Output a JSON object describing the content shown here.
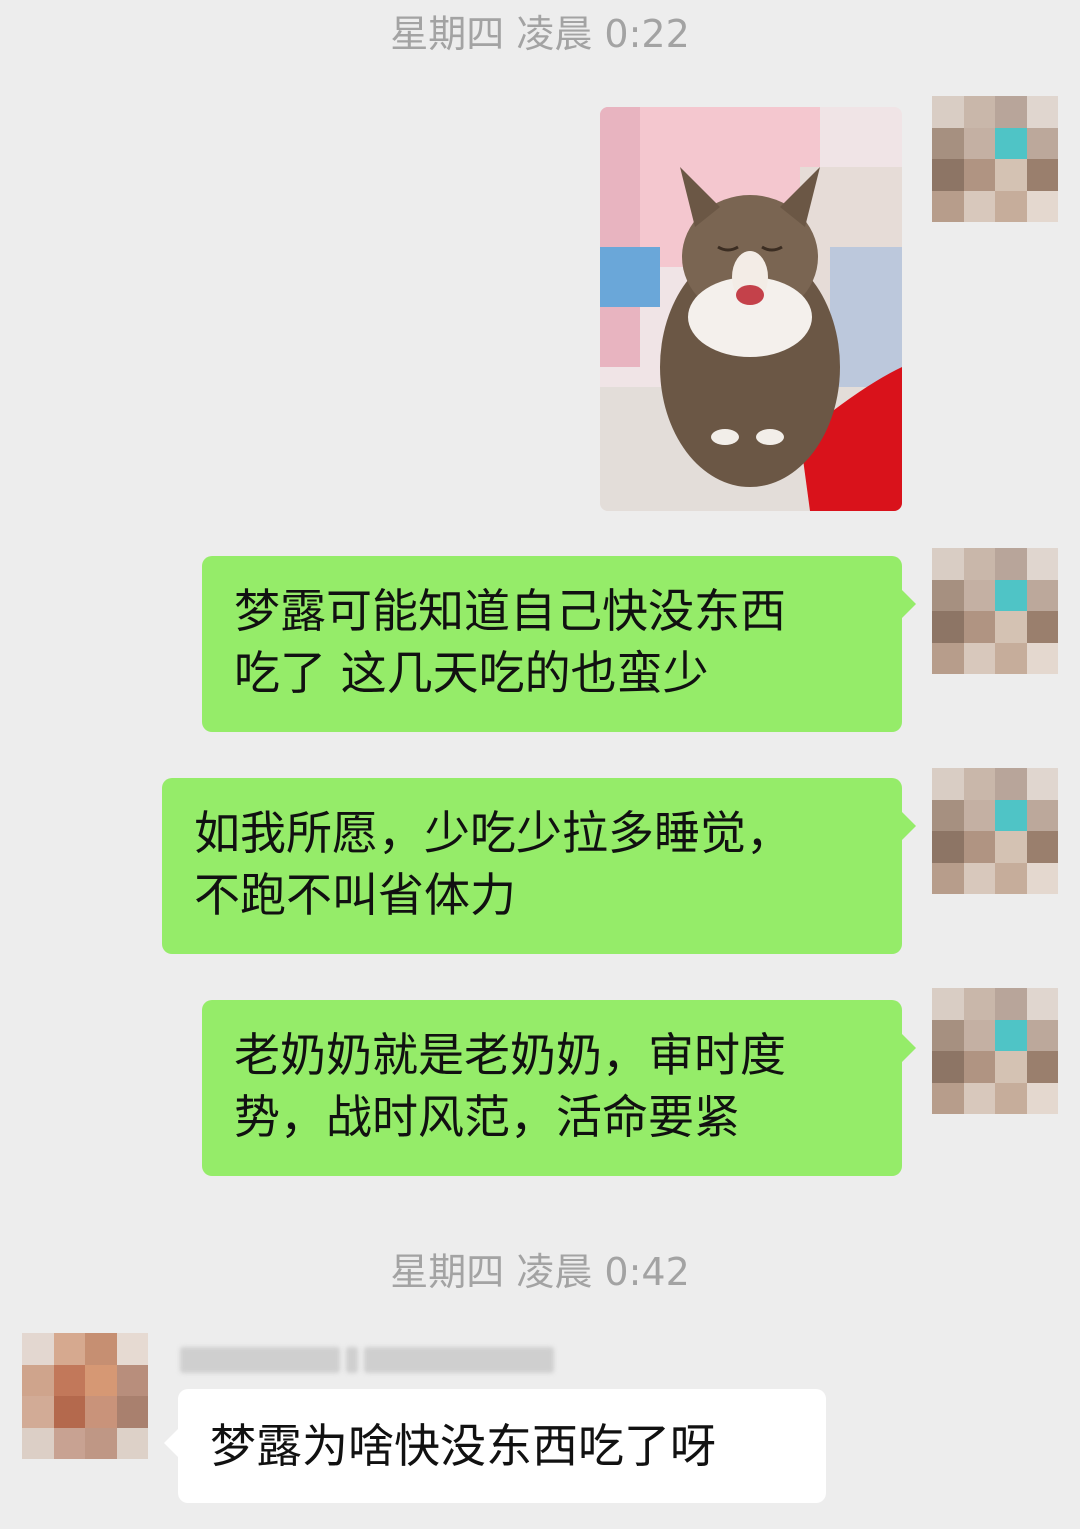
{
  "timestamps": [
    "星期四 凌晨 0:22",
    "星期四 凌晨 0:42"
  ],
  "messages": {
    "msg1": "梦露可能知道自己快没东西\n吃了 这几天吃的也蛮少",
    "msg2": "如我所愿，少吃少拉多睡觉，\n不跑不叫省体力",
    "msg3": "老奶奶就是老奶奶，审时度\n势，战时风范，活命要紧",
    "reply": "梦露为啥快没东西吃了呀"
  },
  "colors": {
    "background": "#ededed",
    "bubble_self": "#95ec69",
    "bubble_other": "#ffffff",
    "timestamp_text": "#a3a3a3"
  },
  "icons": {
    "photo": "cat-photo",
    "avatar_self": "pixelated-avatar",
    "avatar_other": "pixelated-avatar"
  }
}
